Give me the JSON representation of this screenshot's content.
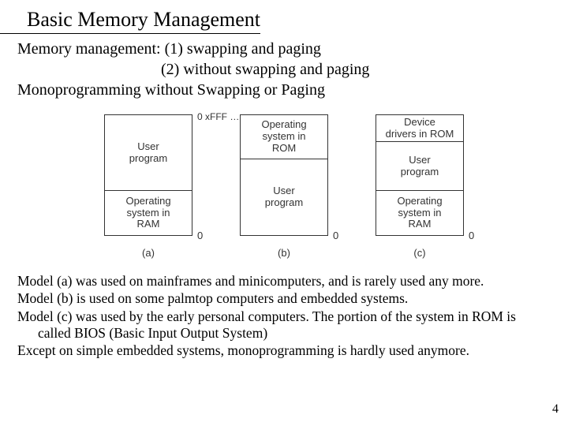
{
  "title": "Basic Memory Management",
  "intro": {
    "line1": "Memory management: (1) swapping and paging",
    "line2": "(2) without swapping and paging",
    "line3": "Monoprogramming without Swapping or Paging"
  },
  "diagram": {
    "addr_top": "0 xFFF …",
    "addr_zero": "0",
    "a": {
      "seg1": "User\nprogram",
      "seg2": "Operating\nsystem in\nRAM",
      "label": "(a)"
    },
    "b": {
      "seg1": "Operating\nsystem in\nROM",
      "seg2": "User\nprogram",
      "label": "(b)"
    },
    "c": {
      "seg1": "Device\ndrivers in ROM",
      "seg2": "User\nprogram",
      "seg3": "Operating\nsystem in\nRAM",
      "label": "(c)"
    }
  },
  "notes": {
    "n1": "Model (a) was used on mainframes and minicomputers, and is rarely used any more.",
    "n2": "Model (b) is used on some palmtop computers and embedded systems.",
    "n3": "Model (c) was used by the early personal computers. The portion of the system in ROM is called BIOS (Basic Input Output System)",
    "n4": "Except on simple embedded systems, monoprogramming is hardly used anymore."
  },
  "page_number": "4"
}
